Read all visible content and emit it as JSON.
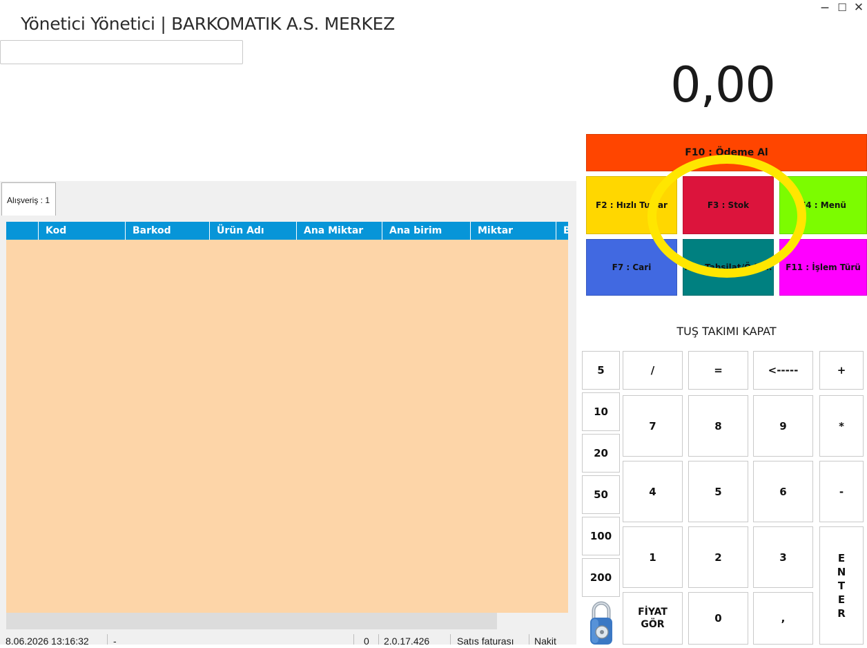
{
  "window": {
    "title": "Yönetici Yönetici | BARKOMATIK A.S. MERKEZ",
    "min_glyph": "‒",
    "max_glyph": "☐",
    "close_glyph": "✕"
  },
  "search": {
    "value": "",
    "placeholder": ""
  },
  "total": "0,00",
  "function_buttons": {
    "f10": {
      "label": "F10 : Ödeme Al"
    },
    "f2": {
      "label": "F2 : Hızlı Tuşlar"
    },
    "f3": {
      "label": "F3 : Stok"
    },
    "f4": {
      "label": "F4 : Menü"
    },
    "f7": {
      "label": "F7 : Cari"
    },
    "f9": {
      "label": "F9 : Tahsilat/Öde..."
    },
    "f11": {
      "label": "F11 : İşlem Türü"
    }
  },
  "keypad": {
    "toggle_label": "TUŞ TAKIMI KAPAT",
    "quick": [
      "5",
      "10",
      "20",
      "50",
      "100",
      "200"
    ],
    "keys": {
      "slash": "/",
      "equals": "=",
      "backspace": "<-----",
      "plus": "+",
      "k7": "7",
      "k8": "8",
      "k9": "9",
      "multiply": "*",
      "k4": "4",
      "k5": "5",
      "k6": "6",
      "minus": "-",
      "k1": "1",
      "k2": "2",
      "k3": "3",
      "enter": "E\nN\nT\nE\nR",
      "price_check": "FİYAT\nGÖR",
      "k0": "0",
      "comma": ","
    }
  },
  "tab": {
    "label": "Alışveriş : 1"
  },
  "grid": {
    "columns": [
      "",
      "Kod",
      "Barkod",
      "Ürün Adı",
      "Ana Miktar",
      "Ana birim",
      "Miktar",
      "B"
    ],
    "rows": []
  },
  "statusbar": {
    "datetime": "8.06.2026 13:16:32",
    "user_field": "-",
    "count": "0",
    "version": "2.0.17.426",
    "doc_type": "Satış faturası",
    "payment": "Nakit"
  },
  "colors": {
    "f10": "#ff4500",
    "f2": "#ffd700",
    "f3": "#dc143c",
    "f4": "#7cfc00",
    "f7": "#4169e1",
    "f9": "#008080",
    "f11": "#ff00ff",
    "grid_header": "#0795d8",
    "grid_body": "#fdd5a8",
    "highlight": "#ffe600"
  },
  "icons": {
    "lock": "padlock-icon"
  }
}
